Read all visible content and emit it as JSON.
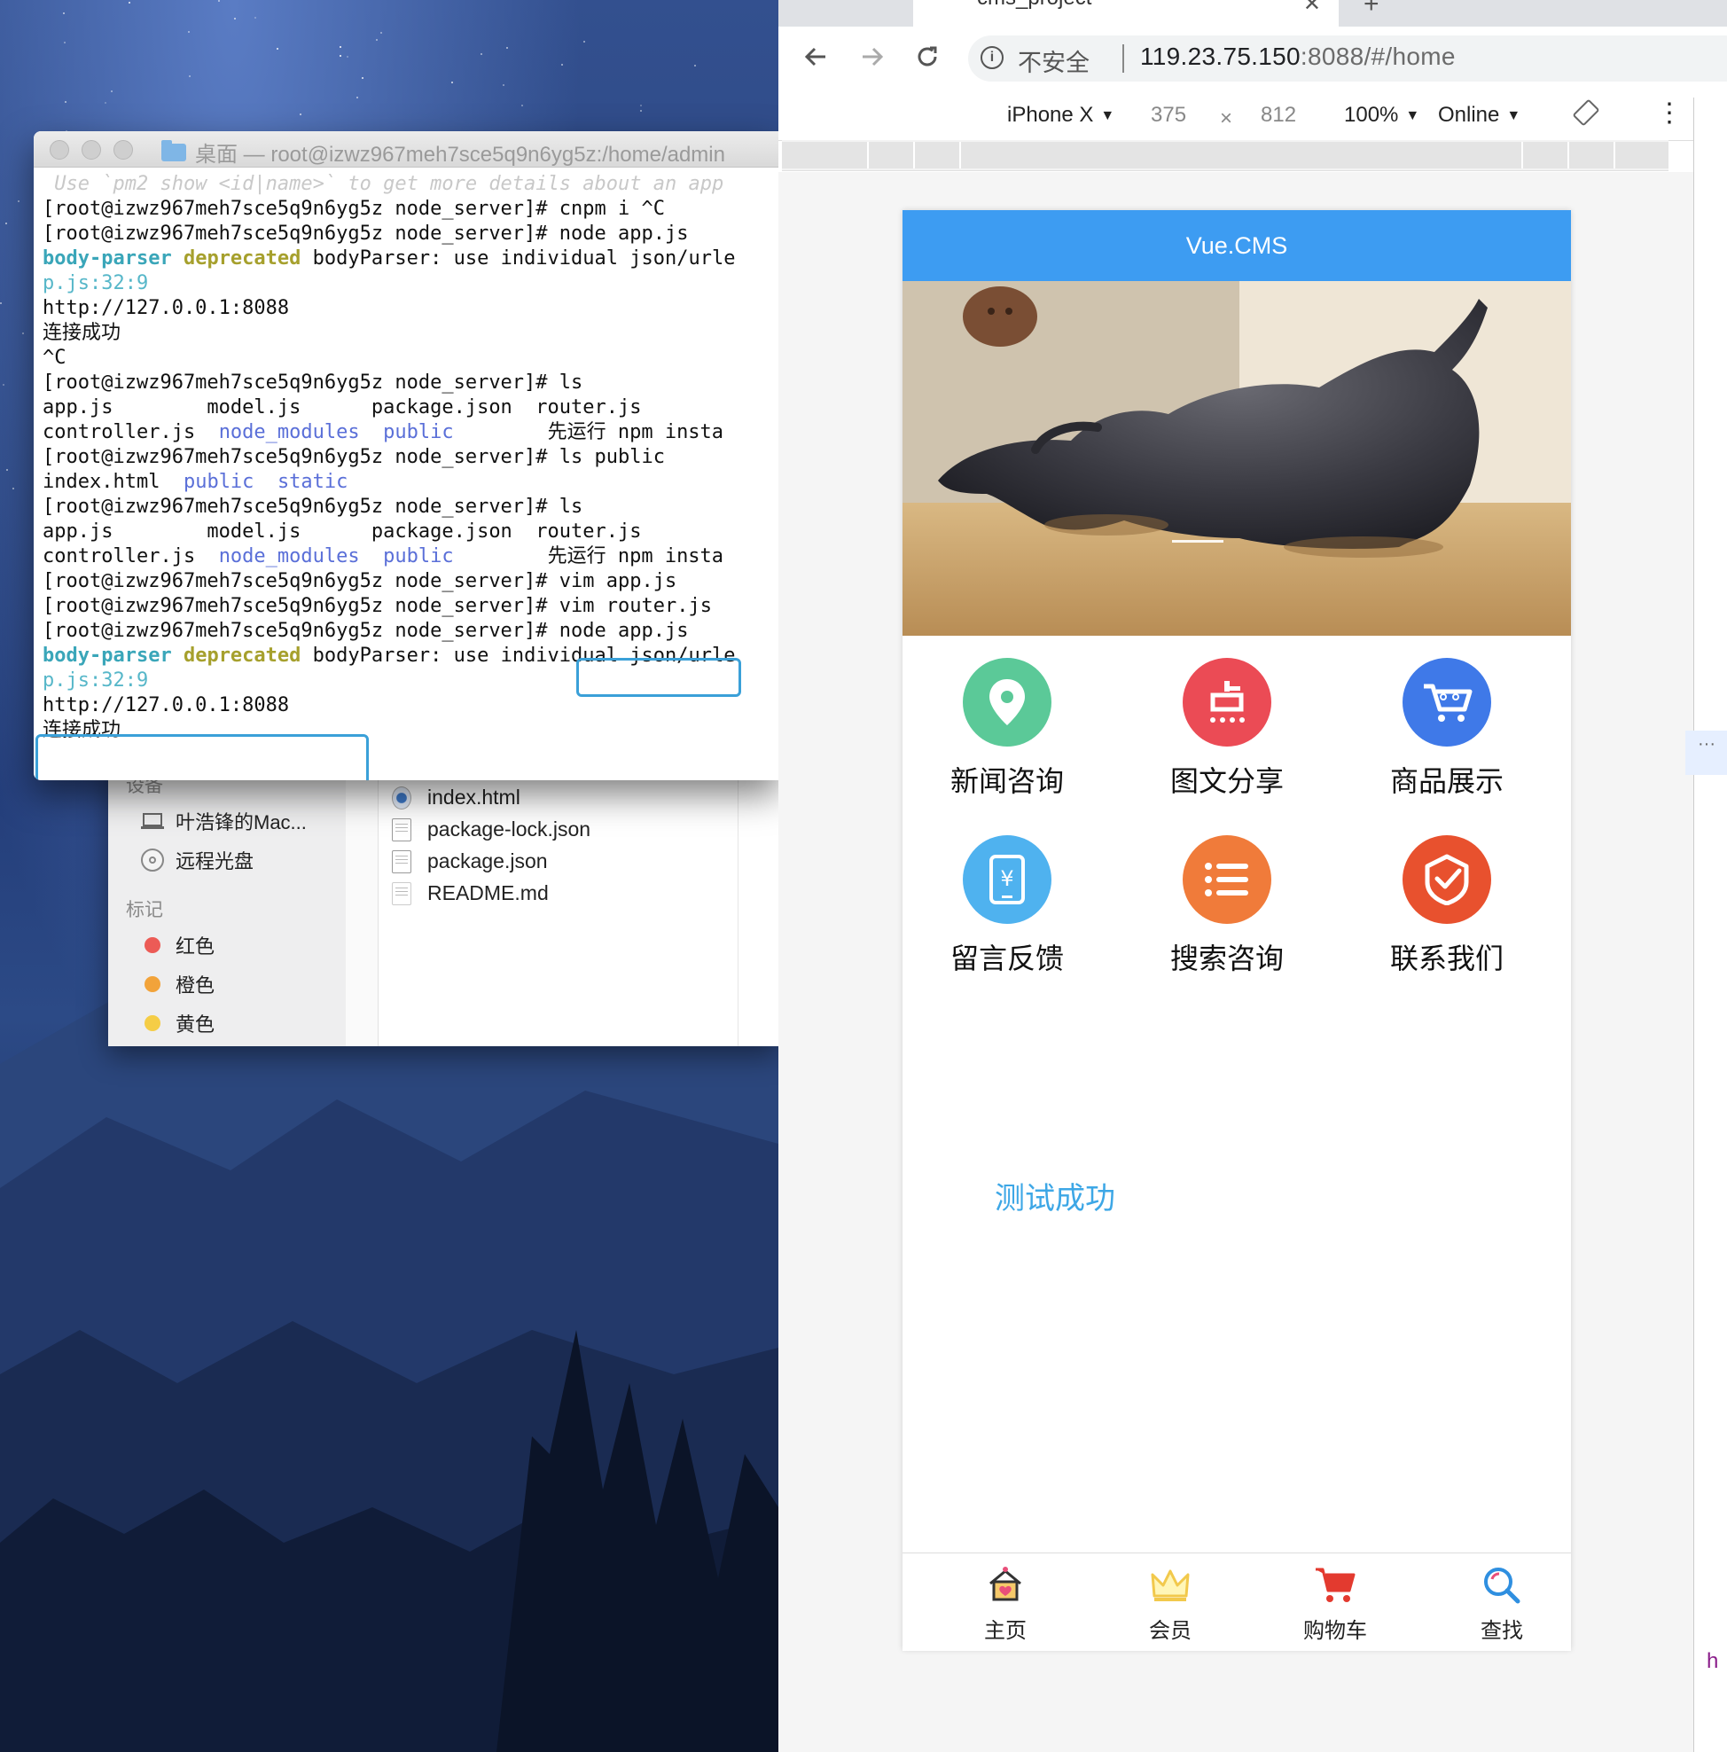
{
  "terminal": {
    "title": "桌面 — root@izwz967meh7sce5q9n6yg5z:/home/admin",
    "lines": [
      " Use `pm2 show <id|name>` to get more details about an app",
      "[root@izwz967meh7sce5q9n6yg5z node_server]# cnpm i ^C",
      "[root@izwz967meh7sce5q9n6yg5z node_server]# node app.js",
      "bodyParser: use individual json/urle",
      "p.js:32:9",
      "http://127.0.0.1:8088",
      "连接成功",
      "^C",
      "[root@izwz967meh7sce5q9n6yg5z node_server]# ls",
      "app.js        model.js      package.json  router.js",
      "controller.js",
      "[root@izwz967meh7sce5q9n6yg5z node_server]# ls public",
      "index.html",
      "[root@izwz967meh7sce5q9n6yg5z node_server]# ls",
      "app.js        model.js      package.json  router.js",
      "controller.js",
      "[root@izwz967meh7sce5q9n6yg5z node_server]# vim app.js",
      "[root@izwz967meh7sce5q9n6yg5z node_server]# vim router.js",
      "[root@izwz967meh7sce5q9n6yg5z node_server]# ",
      "node app.js",
      "bodyParser: use individual json/urle",
      "p.js:32:9",
      "http://127.0.0.1:8088",
      "连接成功"
    ],
    "tokens": {
      "body_parser": "body-parser",
      "deprecated": "deprecated",
      "node_modules": "node_modules",
      "public": "public",
      "static": "static",
      "run_first": "先运行 npm insta"
    }
  },
  "finder": {
    "devices_header": "设备",
    "device_mac": "叶浩锋的Mac...",
    "device_disc": "远程光盘",
    "tags_header": "标记",
    "tags": [
      {
        "label": "红色",
        "color": "#ec5b56"
      },
      {
        "label": "橙色",
        "color": "#f2a33a"
      },
      {
        "label": "黄色",
        "color": "#f5cd46"
      }
    ],
    "files": [
      "index.html",
      "package-lock.json",
      "package.json",
      "README.md"
    ]
  },
  "browser": {
    "tab_title": "cms_project",
    "url_insecure": "不安全",
    "url_host": "119.23.75.150",
    "url_rest": ":8088/#/home",
    "device": "iPhone X",
    "width": "375",
    "times": "×",
    "height": "812",
    "zoom": "100%",
    "network": "Online",
    "more": "⋮",
    "right_panel_dots": "···",
    "right_panel_h": "h"
  },
  "app": {
    "title": "Vue.CMS",
    "grid": [
      {
        "label": "新闻咨询",
        "color": "#5bc998",
        "icon": "location-pin-icon"
      },
      {
        "label": "图文分享",
        "color": "#eb4b55",
        "icon": "dianping-icon"
      },
      {
        "label": "商品展示",
        "color": "#3f79e8",
        "icon": "shopping-cart-icon"
      },
      {
        "label": "留言反馈",
        "color": "#4fb2ef",
        "icon": "phone-yuan-icon"
      },
      {
        "label": "搜索咨询",
        "color": "#f07b3a",
        "icon": "list-icon"
      },
      {
        "label": "联系我们",
        "color": "#e8512e",
        "icon": "shield-check-icon"
      }
    ],
    "test_message": "测试成功",
    "tabs": [
      {
        "label": "主页",
        "icon": "home-icon"
      },
      {
        "label": "会员",
        "icon": "crown-icon"
      },
      {
        "label": "购物车",
        "icon": "cart-icon"
      },
      {
        "label": "查找",
        "icon": "search-icon"
      }
    ]
  }
}
